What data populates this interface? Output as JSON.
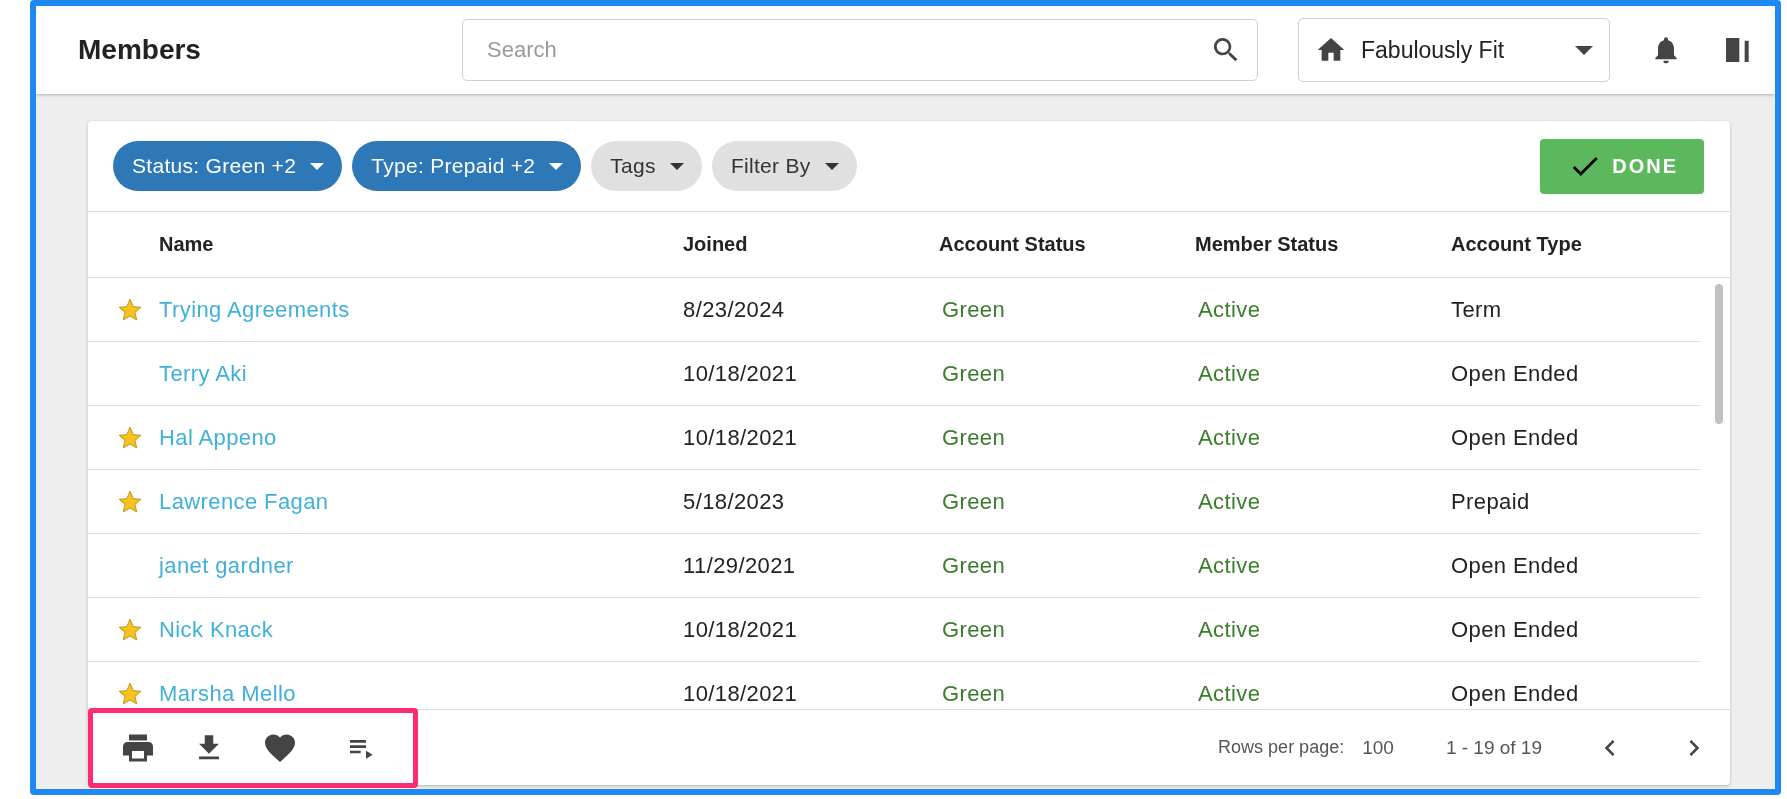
{
  "header": {
    "title": "Members",
    "search": {
      "placeholder": "Search"
    },
    "location": "Fabulously Fit"
  },
  "filters": [
    {
      "label": "Status: Green +2",
      "active": true
    },
    {
      "label": "Type: Prepaid +2",
      "active": true
    },
    {
      "label": "Tags",
      "active": false
    },
    {
      "label": "Filter By",
      "active": false
    }
  ],
  "done_button": "DONE",
  "table": {
    "columns": [
      "Name",
      "Joined",
      "Account Status",
      "Member Status",
      "Account Type"
    ],
    "rows": [
      {
        "starred": true,
        "name": "Trying Agreements",
        "joined": "8/23/2024",
        "account_status": "Green",
        "member_status": "Active",
        "account_type": "Term"
      },
      {
        "starred": false,
        "name": "Terry Aki",
        "joined": "10/18/2021",
        "account_status": "Green",
        "member_status": "Active",
        "account_type": "Open Ended"
      },
      {
        "starred": true,
        "name": "Hal Appeno",
        "joined": "10/18/2021",
        "account_status": "Green",
        "member_status": "Active",
        "account_type": "Open Ended"
      },
      {
        "starred": true,
        "name": "Lawrence Fagan",
        "joined": "5/18/2023",
        "account_status": "Green",
        "member_status": "Active",
        "account_type": "Prepaid"
      },
      {
        "starred": false,
        "name": "janet gardner",
        "joined": "11/29/2021",
        "account_status": "Green",
        "member_status": "Active",
        "account_type": "Open Ended"
      },
      {
        "starred": true,
        "name": "Nick Knack",
        "joined": "10/18/2021",
        "account_status": "Green",
        "member_status": "Active",
        "account_type": "Open Ended"
      },
      {
        "starred": true,
        "name": "Marsha Mello",
        "joined": "10/18/2021",
        "account_status": "Green",
        "member_status": "Active",
        "account_type": "Open Ended"
      }
    ]
  },
  "footer": {
    "rows_per_page_label": "Rows per page:",
    "rows_per_page": "100",
    "range": "1 - 19 of 19"
  }
}
